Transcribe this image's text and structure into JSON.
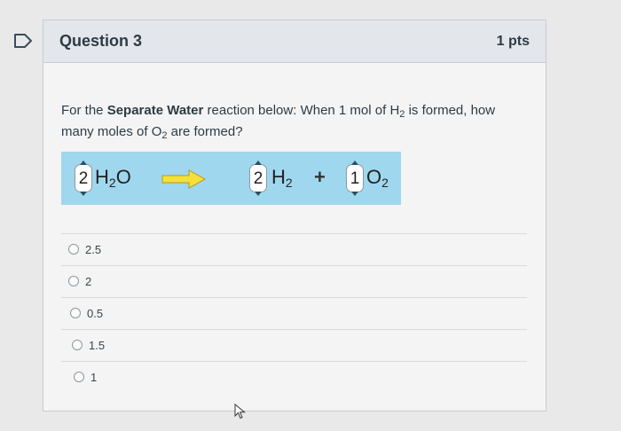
{
  "question": {
    "title": "Question 3",
    "points": "1 pts",
    "text_parts": {
      "p1": "For the ",
      "reaction_name": "Separate Water",
      "p2": " reaction below: When 1 mol of H",
      "h_sub": "2",
      "p3": " is formed, how",
      "p4": "many moles of O",
      "o_sub": "2",
      "p5": " are formed?"
    }
  },
  "reaction": {
    "reactant": {
      "coefficient": "2",
      "formula_main": "H",
      "formula_sub": "2",
      "formula_tail": "O"
    },
    "product1": {
      "coefficient": "2",
      "formula_main": "H",
      "formula_sub": "2"
    },
    "plus": "+",
    "product2": {
      "coefficient": "1",
      "formula_main": "O",
      "formula_sub": "2"
    },
    "arrow_color": "#f5e03a"
  },
  "answers": [
    {
      "label": "2.5"
    },
    {
      "label": "2"
    },
    {
      "label": "0.5"
    },
    {
      "label": "1.5"
    },
    {
      "label": "1"
    }
  ],
  "colors": {
    "header_bg": "#e3e6ea",
    "card_bg": "#f4f4f4",
    "reaction_bg": "#9fd7ef",
    "text": "#2d3b45"
  }
}
